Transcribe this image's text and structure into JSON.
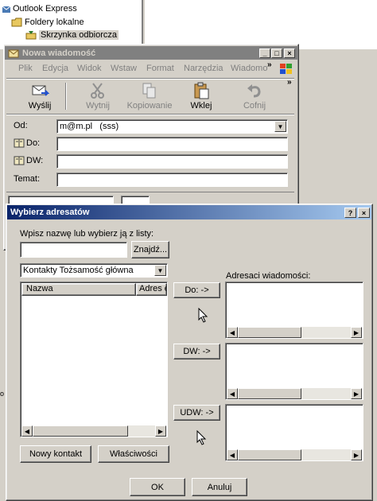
{
  "background_window": {
    "tree": [
      {
        "label": "Outlook Express"
      },
      {
        "label": "Foldery lokalne"
      },
      {
        "label": "Skrzynka odbiorcza"
      }
    ]
  },
  "compose_window": {
    "title": "Nowa wiadomość",
    "menu": [
      "Plik",
      "Edycja",
      "Widok",
      "Wstaw",
      "Format",
      "Narzędzia",
      "Wiadomo"
    ],
    "toolbar": {
      "send": "Wyślij",
      "cut": "Wytnij",
      "copy": "Kopiowanie",
      "paste": "Wklej",
      "undo": "Cofnij"
    },
    "fields": {
      "from_label": "Od:",
      "from_value": "m@m.pl   (sss)",
      "to_label": "Do:",
      "cc_label": "DW:",
      "subject_label": "Temat:"
    }
  },
  "dialog": {
    "title": "Wybierz adresatów",
    "help_label": "?",
    "close_label": "×",
    "search_prompt": "Wpisz nazwę lub wybierz ją z listy:",
    "search_value": "",
    "find_button": "Znajdź...",
    "contacts_select": "Kontakty Tożsamość główna",
    "list_headers": [
      "Nazwa",
      "Adres e-"
    ],
    "recipients_label": "Adresaci wiadomości:",
    "to_button": "Do: ->",
    "cc_button": "DW: ->",
    "bcc_button": "UDW: ->",
    "new_contact_button": "Nowy kontakt",
    "properties_button": "Właściwości",
    "ok_button": "OK",
    "cancel_button": "Anuluj"
  },
  "colors": {
    "title_active_start": "#0a246a",
    "title_active_end": "#a6caf0",
    "title_inactive": "#808080",
    "face": "#d4d0c8"
  }
}
